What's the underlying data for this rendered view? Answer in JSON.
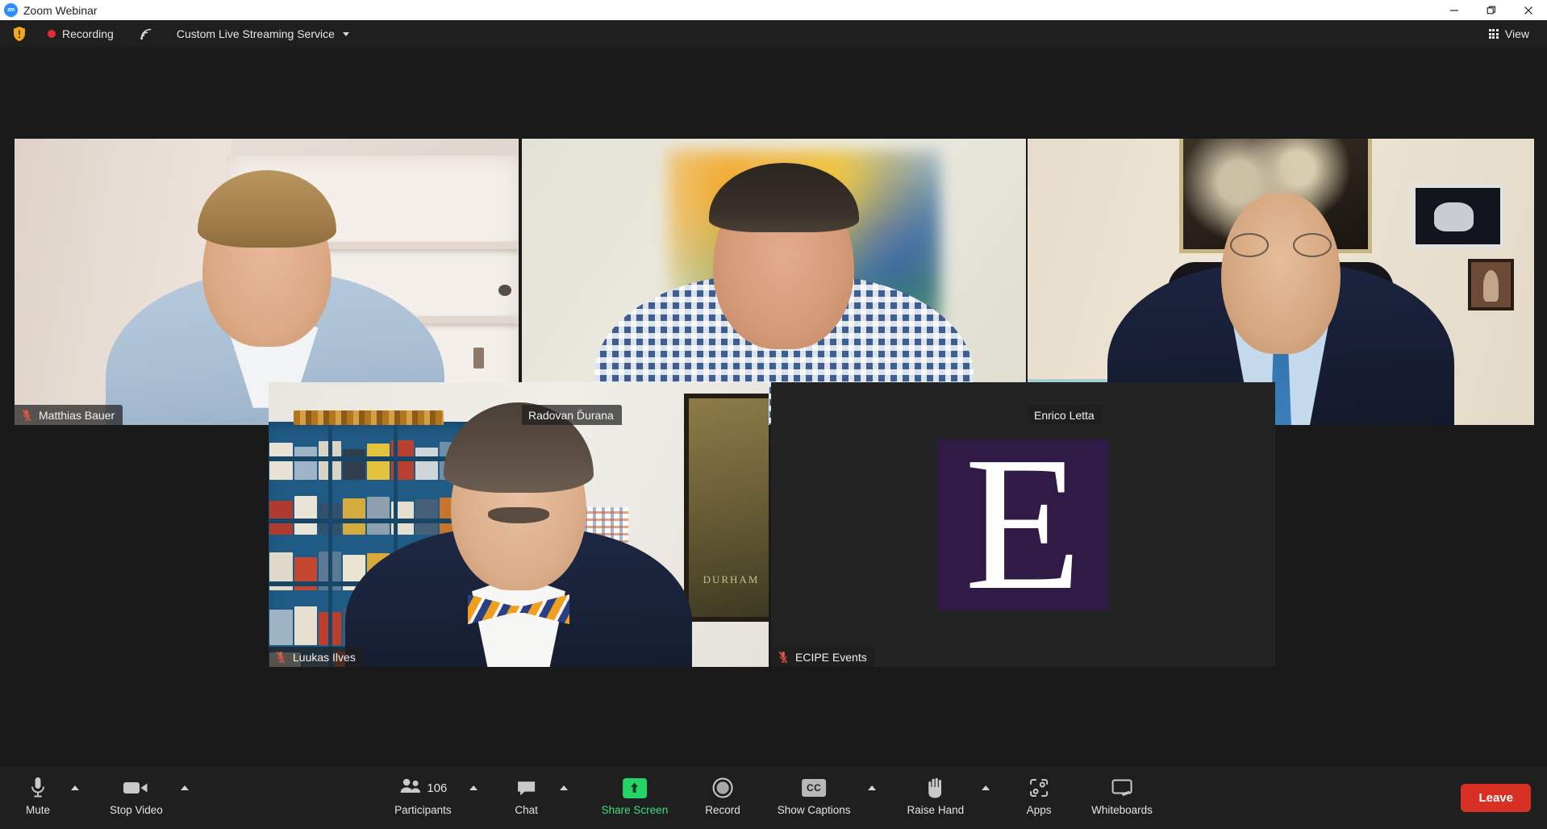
{
  "window": {
    "app_logo_text": "zm",
    "title": "Zoom Webinar",
    "minimize_icon": "minimize-icon",
    "restore_icon": "restore-icon",
    "close_icon": "close-icon"
  },
  "topbar": {
    "security_icon": "shield-warning-icon",
    "recording_label": "Recording",
    "recording_dot_color": "#e02d2d",
    "stream_icon": "live-stream-icon",
    "stream_service": "Custom Live Streaming Service",
    "stream_caret_icon": "chevron-down-icon",
    "view_label": "View",
    "view_icon": "grid-view-icon"
  },
  "participants_grid": {
    "active_speaker_border_color": "#f3f07a",
    "tiles": [
      {
        "name": "Matthias Bauer",
        "muted": true,
        "active_speaker": false,
        "mic_icon": "microphone-muted-icon",
        "avatar_letter": ""
      },
      {
        "name": "Radovan Ďurana",
        "muted": false,
        "active_speaker": false,
        "mic_icon": "",
        "avatar_letter": ""
      },
      {
        "name": "Enrico Letta",
        "muted": false,
        "active_speaker": true,
        "mic_icon": "",
        "avatar_letter": ""
      },
      {
        "name": "Luukas Ilves",
        "muted": true,
        "active_speaker": false,
        "mic_icon": "microphone-muted-icon",
        "avatar_letter": ""
      },
      {
        "name": "ECIPE Events",
        "muted": true,
        "active_speaker": false,
        "mic_icon": "microphone-muted-icon",
        "avatar_letter": "E"
      }
    ],
    "logo_tile": {
      "letter": "E",
      "bg_color": "#2f1b46",
      "letter_color": "#ffffff"
    },
    "poster_text": "DURHAM"
  },
  "controlbar": {
    "mute": {
      "label": "Mute",
      "icon": "microphone-icon",
      "arrow_icon": "chevron-up-icon"
    },
    "video": {
      "label": "Stop Video",
      "icon": "camera-icon",
      "arrow_icon": "chevron-up-icon"
    },
    "participants": {
      "label": "Participants",
      "count": "106",
      "icon": "participants-icon",
      "arrow_icon": "chevron-up-icon"
    },
    "chat": {
      "label": "Chat",
      "icon": "chat-bubble-icon",
      "arrow_icon": "chevron-up-icon"
    },
    "share_screen": {
      "label": "Share Screen",
      "icon": "share-screen-up-arrow-icon",
      "accent": "#3ce07a"
    },
    "record": {
      "label": "Record",
      "icon": "record-circle-icon"
    },
    "captions": {
      "label": "Show Captions",
      "icon": "cc-icon",
      "icon_text": "CC",
      "arrow_icon": "chevron-up-icon"
    },
    "raise_hand": {
      "label": "Raise Hand",
      "icon": "raised-hand-icon",
      "arrow_icon": "chevron-up-icon"
    },
    "apps": {
      "label": "Apps",
      "icon": "apps-icon"
    },
    "whiteboards": {
      "label": "Whiteboards",
      "icon": "whiteboard-icon"
    },
    "leave": {
      "label": "Leave",
      "color": "#d93025"
    }
  }
}
